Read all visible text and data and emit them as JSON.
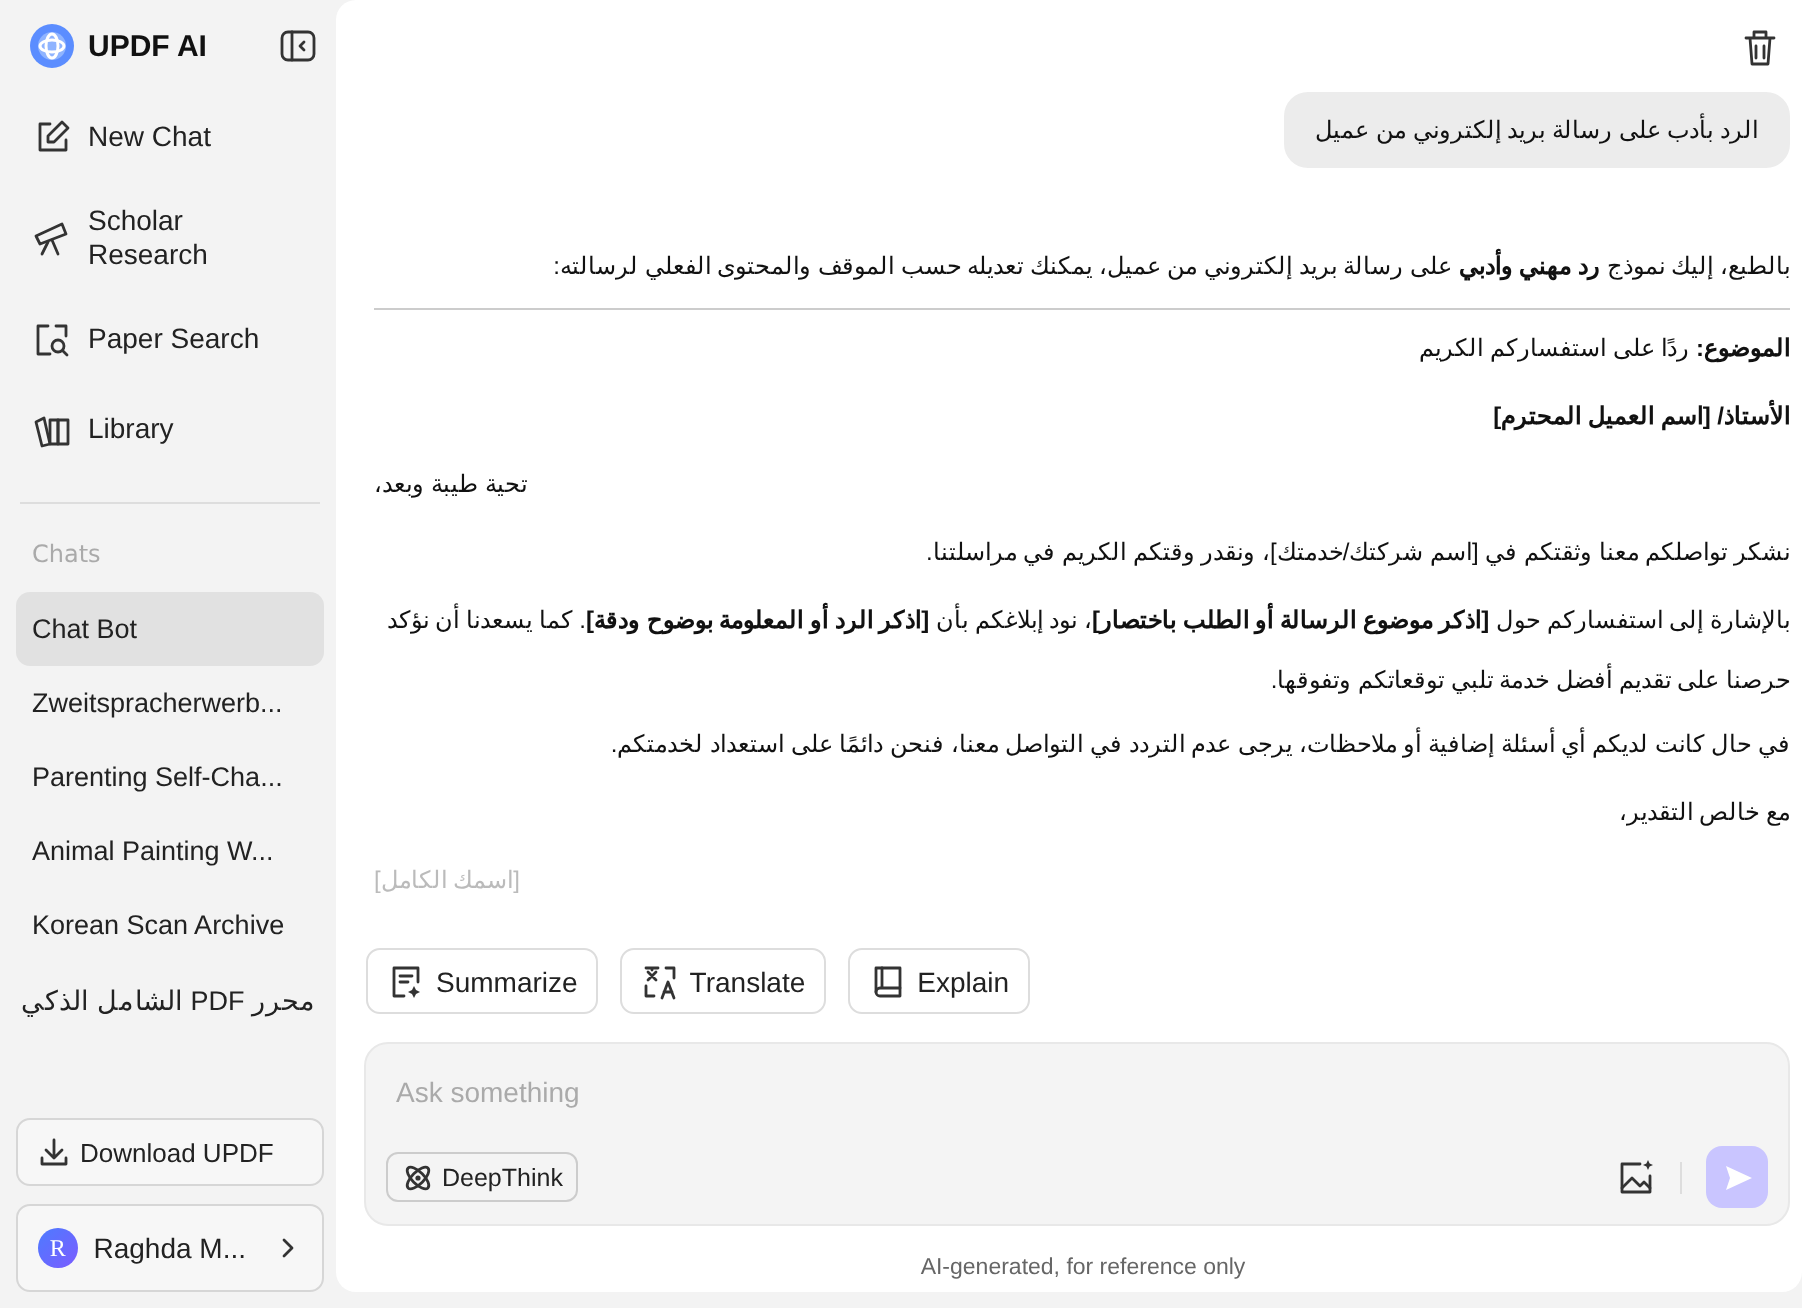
{
  "app": {
    "title": "UPDF AI"
  },
  "nav": [
    {
      "label": "New Chat",
      "kind": "new"
    },
    {
      "label": "Scholar\nResearch",
      "kind": "scholar"
    },
    {
      "label": "Paper Search",
      "kind": "paper"
    },
    {
      "label": "Library",
      "kind": "library"
    }
  ],
  "chats": {
    "heading": "Chats",
    "items": [
      {
        "label": "Chat Bot",
        "selected": true
      },
      {
        "label": "Zweitspracherwerb...",
        "selected": false
      },
      {
        "label": "Parenting Self-Cha...",
        "selected": false
      },
      {
        "label": "Animal Painting W...",
        "selected": false
      },
      {
        "label": "Korean Scan Archive",
        "selected": false
      },
      {
        "label": "محرر PDF الشامل الذكي",
        "selected": false
      }
    ]
  },
  "download_button": "Download UPDF",
  "user": {
    "initial": "R",
    "name": "Raghda M..."
  },
  "conversation": {
    "user_message": "الرد بأدب على رسالة بريد إلكتروني من عميل",
    "intro": "بالطبع، إليك نموذج **رد مهني وأدبي** على رسالة بريد إلكتروني من عميل، يمكنك تعديله حسب الموقف والمحتوى الفعلي لرسالته:",
    "paragraphs": [
      {
        "text": "**الموضوع:** ردًا على استفساركم الكريم",
        "kind": "body"
      },
      {
        "text": "الأستاذ/ [اسم العميل المحترم]",
        "kind": "heading"
      },
      {
        "text": "تحية طيبة وبعد،",
        "kind": "greeting"
      },
      {
        "text": "نشكر تواصلكم معنا وثقتكم في [اسم شركتك/خدمتك]، ونقدر وقتكم الكريم في مراسلتنا.",
        "kind": "body"
      },
      {
        "text": "بالإشارة إلى استفساركم حول **[اذكر موضوع الرسالة أو الطلب باختصار]**، نود إبلاغكم بأن **[اذكر الرد أو المعلومة بوضوح ودقة]**. كما يسعدنا أن نؤكد حرصنا على تقديم أفضل خدمة تلبي توقعاتكم وتفوقها.",
        "kind": "body"
      },
      {
        "text": "في حال كانت لديكم أي أسئلة إضافية أو ملاحظات، يرجى عدم التردد في التواصل معنا، فنحن دائمًا على استعداد لخدمتكم.",
        "kind": "body"
      },
      {
        "text": "مع خالص التقدير،",
        "kind": "body"
      },
      {
        "text": "[اسمك الكامل]",
        "kind": "signature"
      }
    ]
  },
  "actions": {
    "summarize": "Summarize",
    "translate": "Translate",
    "explain": "Explain"
  },
  "input": {
    "placeholder": "Ask something",
    "deepthink": {
      "label": "DeepThink",
      "on": false
    }
  },
  "footer": "AI-generated, for reference only"
}
